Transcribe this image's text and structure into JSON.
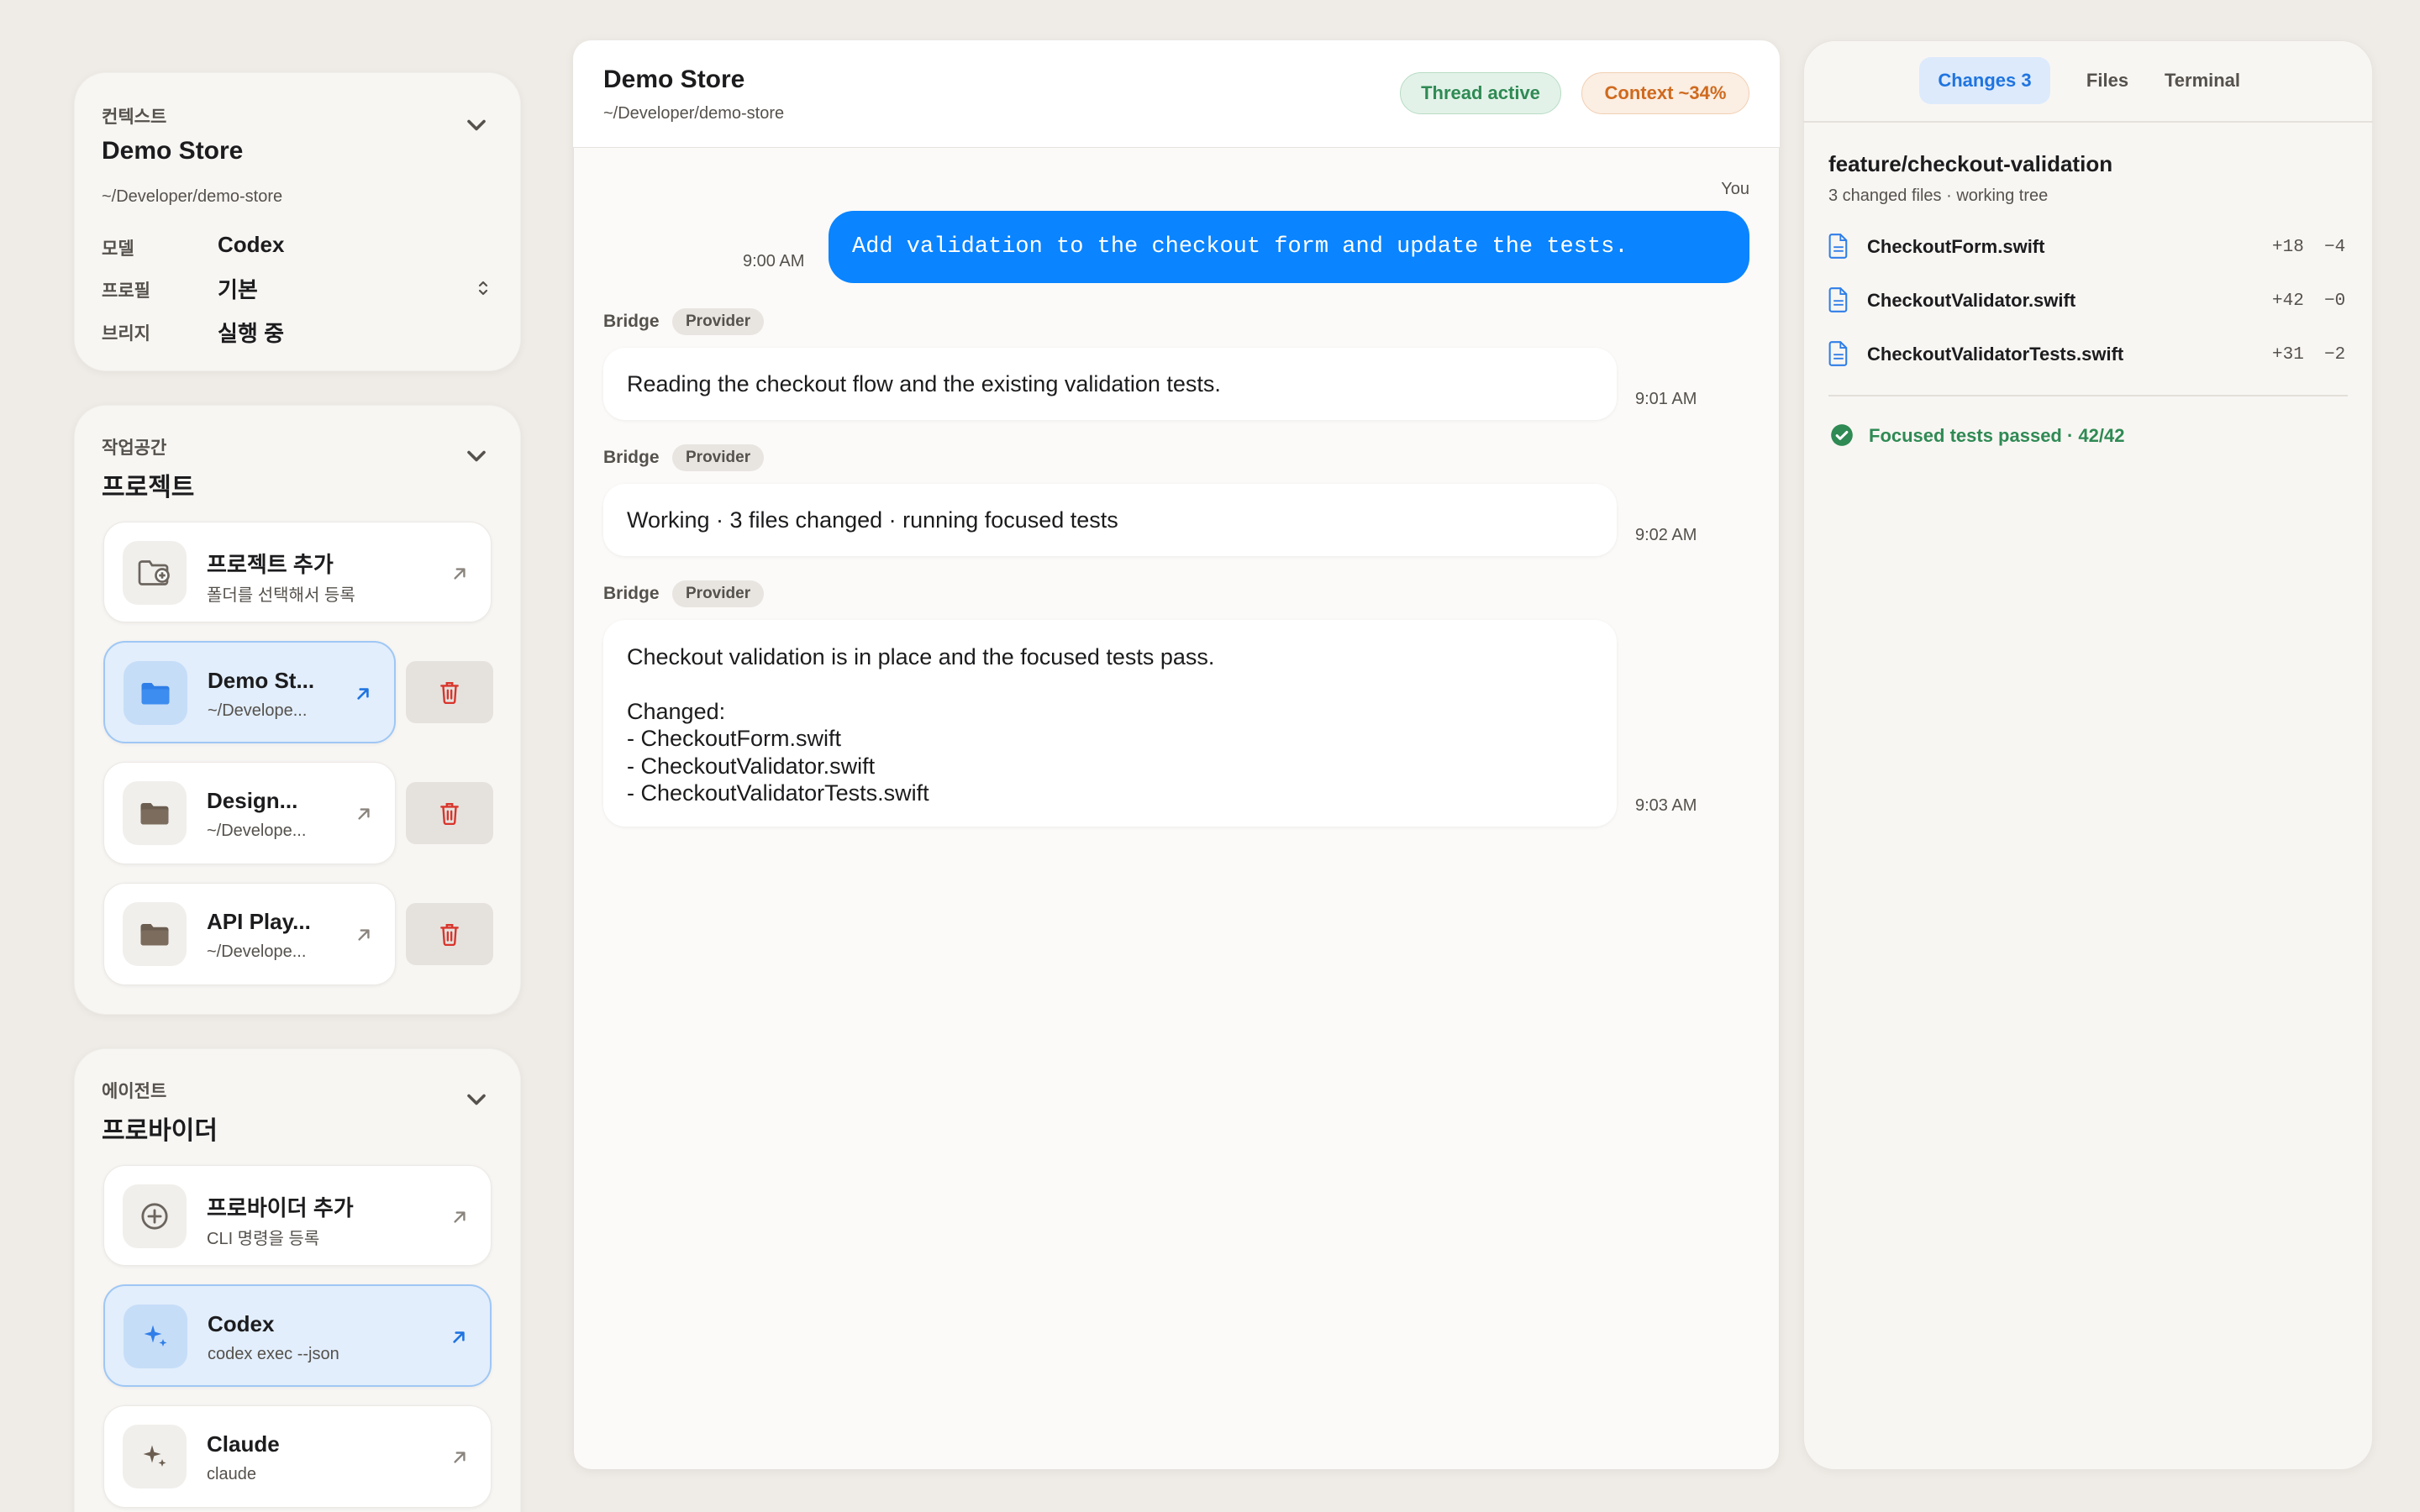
{
  "context": {
    "eyebrow": "컨텍스트",
    "title": "Demo Store",
    "path": "~/Developer/demo-store",
    "rows": [
      {
        "key": "모델",
        "value": "Codex"
      },
      {
        "key": "프로필",
        "value": "기본"
      },
      {
        "key": "브리지",
        "value": "실행 중"
      }
    ]
  },
  "workspace": {
    "eyebrow": "작업공간",
    "title": "프로젝트",
    "add": {
      "label": "프로젝트 추가",
      "sub": "폴더를 선택해서 등록"
    },
    "projects": [
      {
        "label": "Demo St...",
        "sub": "~/Develope...",
        "selected": true
      },
      {
        "label": "Design...",
        "sub": "~/Develope..."
      },
      {
        "label": "API Play...",
        "sub": "~/Develope..."
      }
    ]
  },
  "agents": {
    "eyebrow": "에이전트",
    "title": "프로바이더",
    "add": {
      "label": "프로바이더 추가",
      "sub": "CLI 명령을 등록"
    },
    "providers": [
      {
        "label": "Codex",
        "sub": "codex exec --json",
        "selected": true
      },
      {
        "label": "Claude",
        "sub": "claude"
      }
    ]
  },
  "chat": {
    "title": "Demo Store",
    "path": "~/Developer/demo-store",
    "badges": {
      "thread": "Thread active",
      "context": "Context ~34%"
    },
    "you_label": "You",
    "user_message": {
      "text": "Add validation to the checkout form and update the tests.",
      "time": "9:00 AM"
    },
    "messages": [
      {
        "sender": "Bridge",
        "tag": "Provider",
        "text": "Reading the checkout flow and the existing validation tests.",
        "time": "9:01 AM"
      },
      {
        "sender": "Bridge",
        "tag": "Provider",
        "text": "Working · 3 files changed · running focused tests",
        "time": "9:02 AM"
      },
      {
        "sender": "Bridge",
        "tag": "Provider",
        "lines": [
          "Checkout validation is in place and the focused tests pass.",
          "",
          "Changed:",
          "- CheckoutForm.swift",
          "- CheckoutValidator.swift",
          "- CheckoutValidatorTests.swift"
        ],
        "time": "9:03 AM"
      }
    ]
  },
  "right": {
    "tabs": [
      "Changes 3",
      "Files",
      "Terminal"
    ],
    "branch": "feature/checkout-validation",
    "summary": "3 changed files · working tree",
    "files": [
      {
        "name": "CheckoutForm.swift",
        "add": "+18",
        "del": "−4"
      },
      {
        "name": "CheckoutValidator.swift",
        "add": "+42",
        "del": "−0"
      },
      {
        "name": "CheckoutValidatorTests.swift",
        "add": "+31",
        "del": "−2"
      }
    ],
    "status": "Focused tests passed · 42/42"
  },
  "icons": {
    "chevron": "chevron-down-icon",
    "arrow": "arrow-up-right-icon",
    "trash": "trash-icon",
    "folder": "folder-icon",
    "folder_add": "folder-plus-icon",
    "plus_circle": "plus-circle-icon",
    "sparkle": "sparkle-icon",
    "file": "file-icon",
    "check": "check-circle-icon",
    "updown": "chevron-up-down-icon"
  },
  "colors": {
    "accent": "#0a84ff",
    "danger": "#d9342b",
    "success": "#2f8a54",
    "warning": "#cf6a1e"
  }
}
